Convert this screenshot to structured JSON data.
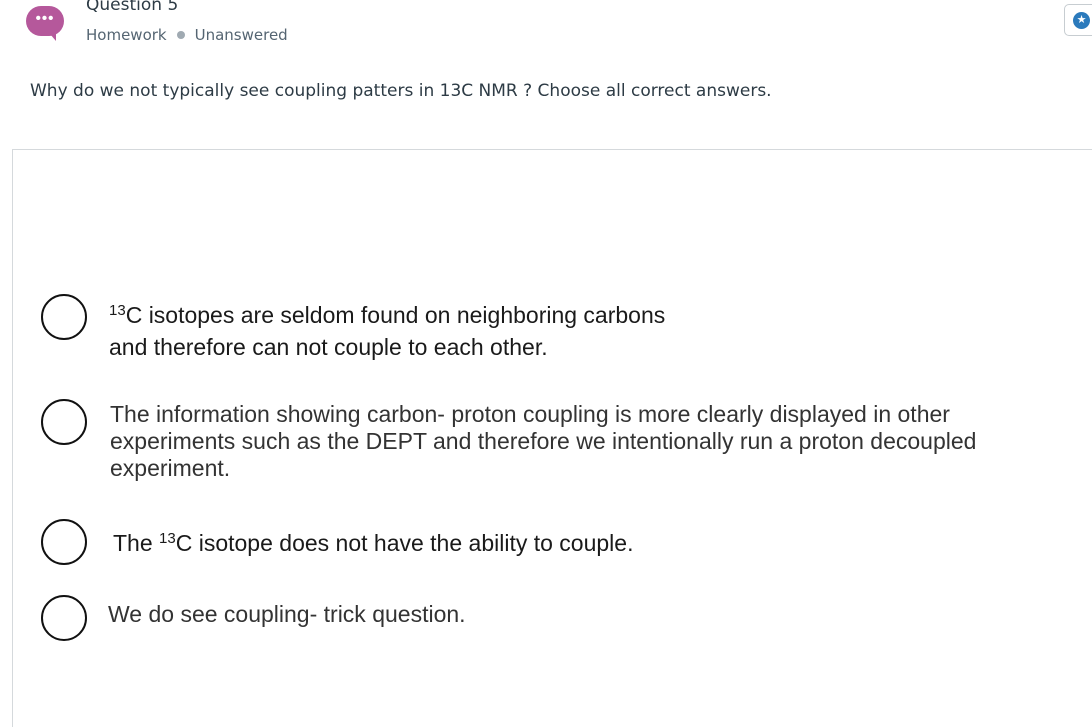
{
  "header": {
    "avatar_dots": "•••",
    "question_title": "Question 5",
    "category": "Homework",
    "status": "Unanswered",
    "bookmark_icon": "star-icon",
    "accent_color": "#b5589b",
    "bookmark_color": "#2b7abc"
  },
  "question": {
    "text": "Why do we not typically see coupling patters in 13C NMR ? Choose all correct answers."
  },
  "options": [
    {
      "line1_sup": "13",
      "line1_rest": "C isotopes are seldom found on neighboring carbons",
      "line2": "and therefore can not couple to each other."
    },
    {
      "line1": "The information showing carbon- proton coupling is more clearly displayed in other",
      "line2": "experiments such as the DEPT and therefore we intentionally run a proton decoupled",
      "line3": "experiment."
    },
    {
      "pre": "The ",
      "sup": "13",
      "rest": "C isotope does not have the ability to couple."
    },
    {
      "text": "We do see coupling- trick question."
    }
  ]
}
